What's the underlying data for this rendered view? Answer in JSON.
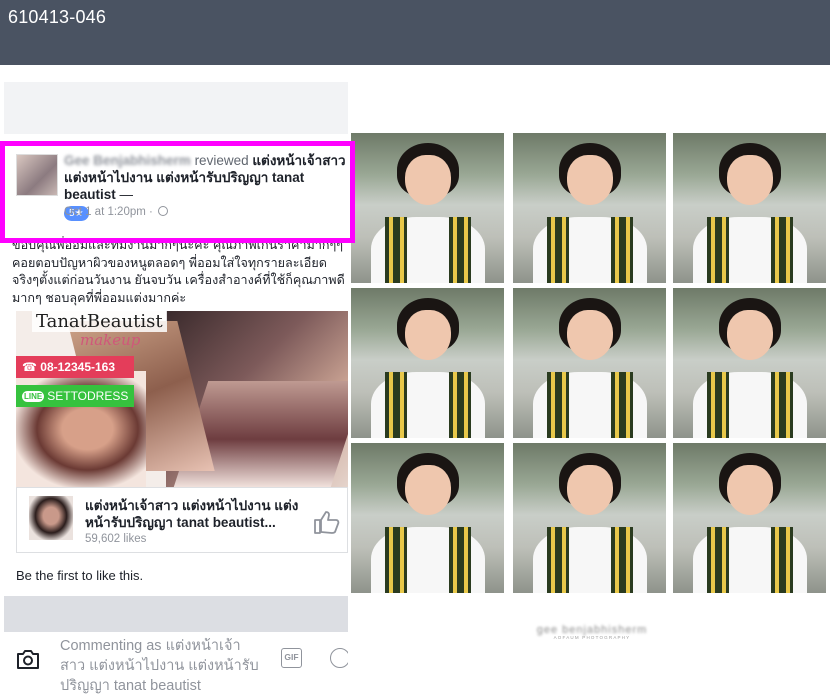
{
  "header": {
    "code": "610413-046"
  },
  "post": {
    "reviewer_name": "Gee Benjabhisherm",
    "action": "reviewed",
    "page_name": "แต่งหน้าเจ้าสาว แต่งหน้าไปงาน แต่งหน้ารับปริญญา tanat beautist",
    "dash": "—",
    "rating": "5★",
    "time": "Oct 1 at 1:20pm ·",
    "review_text": "ขอบคุณพี่ออมและทีมงานมากๆนะคะ คุณภาพเกินราคามากๆๆ คอยตอบปัญหาผิวของหนูตลอดๆ พี่ออมใส่ใจทุกรายละเอียดจริงๆตั้งแต่ก่อนวันงาน ยันจบวัน เครื่องสำอางค์ที่ใช้ก็คุณภาพดีมากๆ ชอบลุคที่พี่ออมแต่งมากค่ะ"
  },
  "ad": {
    "brand": "TanatBeautist",
    "brand_sub": "makeup",
    "phone": "08-12345-163",
    "line_badge": "LINE",
    "line_id": "SETTODRESS"
  },
  "page_card": {
    "name": "แต่งหน้าเจ้าสาว แต่งหน้าไปงาน แต่งหน้ารับปริญญา tanat beautist...",
    "likes": "59,602 likes"
  },
  "first_like": "Be the first to like this.",
  "composer": {
    "placeholder": "Commenting as แต่งหน้าเจ้าสาว แต่งหน้าไปงาน แต่งหน้ารับปริญญา tanat beautist",
    "gif_label": "GIF"
  },
  "photos": [
    "photo-1",
    "photo-2",
    "photo-3",
    "photo-4",
    "photo-5",
    "photo-6",
    "photo-7",
    "photo-8",
    "photo-9"
  ],
  "signature": {
    "name": "gee benjabhisherm",
    "studio": "AOFAUM PHOTOGRAPHY"
  },
  "colors": {
    "topbar": "#4a5362",
    "highlight": "#ff00ff",
    "fb_blue": "#5890ff",
    "line_green": "#36c23e",
    "phone_red": "#e43d5a"
  }
}
